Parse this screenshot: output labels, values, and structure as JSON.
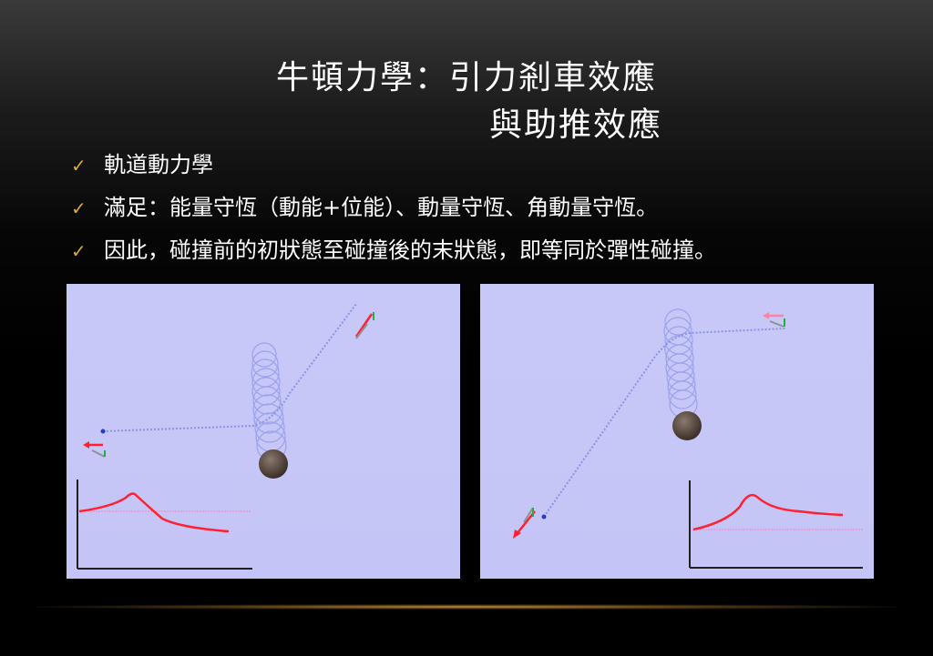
{
  "slide": {
    "title_line1": "牛頓力學：引力剎車效應",
    "title_line2": "與助推效應",
    "bullets": [
      "軌道動力學",
      "滿足：能量守恆（動能+位能）、動量守恆、角動量守恆。",
      "因此，碰撞前的初狀態至碰撞後的末狀態，即等同於彈性碰撞。"
    ],
    "check_symbol": "✓"
  },
  "colors": {
    "accent_check": "#d9a93a",
    "panel_bg": "#c6c6f7",
    "planet": "#4a3d35",
    "path": "#7a86e0",
    "curve": "#ff2030",
    "baseline": "#ff80c0"
  },
  "panels": [
    {
      "name": "left-simulation",
      "effect": "brake"
    },
    {
      "name": "right-simulation",
      "effect": "boost"
    }
  ]
}
